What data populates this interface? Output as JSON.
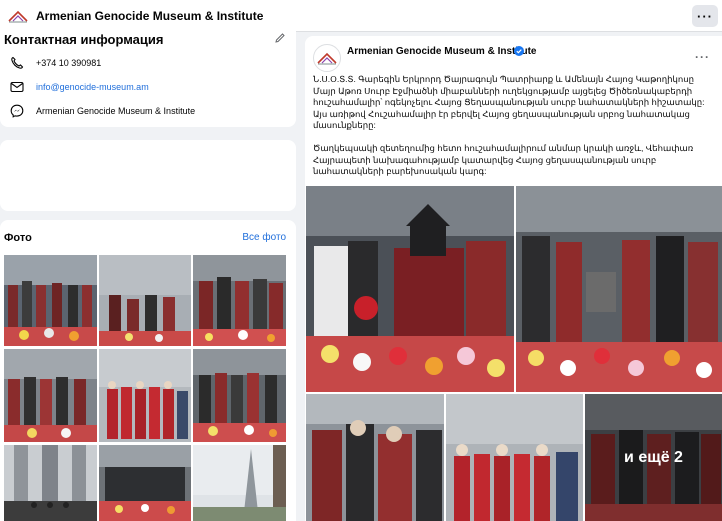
{
  "header": {
    "page_name": "Armenian Genocide Museum & Institute",
    "more_label": "···"
  },
  "contact": {
    "title": "Контактная информация",
    "phone": "+374 10 390981",
    "email": "info@genocide-museum.am",
    "messenger": "Armenian Genocide Museum & Institute"
  },
  "photos": {
    "title": "Фото",
    "see_all": "Все фото"
  },
  "post": {
    "author": "Armenian Genocide Museum & Institute",
    "more_label": "···",
    "paragraph1": "Ն.Ս.Օ.Տ.Տ. Գարեգին Երկրորդ Ծայրագույն Պատրիարք և Ամենայն Հայոց Կաթողիկոսը Մայր Աթոռ Սուրբ Էջմիածնի միաբանների ուղեկցությամբ այցելեց Ծիծեռնակաբերդի հուշահամալիր՝ ոգեկոչելու Հայոց Ցեղասպանության սուրբ նահատակների հիշատակը: Այս առիթով Հուշահամալիր էր բերվել Հայոց ցեղասպանության սրբոց նահատակաց մասունքները:",
    "paragraph2": "Ծաղկեպսակի զետեղումից հետո հուշահամալիրում անմար կրակի առջև, Վեհափառ Հայրապետի նախագահությամբ կատարվեց Հայոց ցեղասպանության սուրբ նահատակների բարեխոսական կարգ:",
    "more_photos": "и ещё 2"
  },
  "colors": {
    "link": "#216fdb",
    "background": "#f0f2f5",
    "verified": "#1877f2"
  }
}
